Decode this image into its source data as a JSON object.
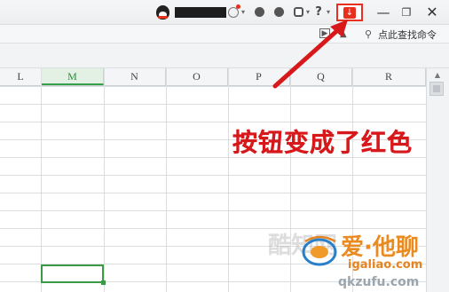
{
  "titlebar": {
    "username": "•••••••",
    "help_label": "?",
    "caret": "▾",
    "download_glyph": "↓",
    "minimize_glyph": "—",
    "maximize_glyph": "❐",
    "close_glyph": "✕"
  },
  "toolbar": {
    "search_label": "点此查找命令"
  },
  "sheet": {
    "columns": [
      "L",
      "M",
      "N",
      "O",
      "P",
      "Q",
      "R"
    ],
    "selected_column": "M"
  },
  "annotation": {
    "text": "按钮变成了红色",
    "color": "#d7191c"
  },
  "watermark": {
    "faint_text": "酷知网",
    "brand": "爱·他聊",
    "url": "igaliao.com",
    "url2": "qkzufu.com"
  },
  "colors": {
    "accent_green": "#34a04a",
    "highlight_red": "#e8301f"
  }
}
